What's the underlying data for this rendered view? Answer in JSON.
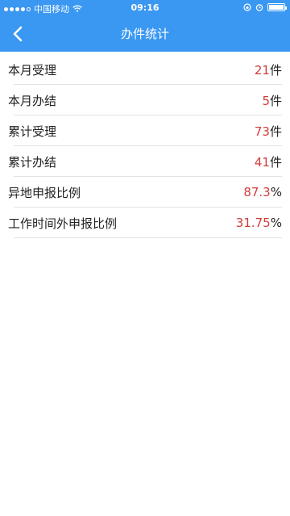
{
  "status_bar": {
    "carrier": "中国移动",
    "time": "09:16"
  },
  "nav": {
    "title": "办件统计"
  },
  "stats": [
    {
      "label": "本月受理",
      "value": "21",
      "unit": "件"
    },
    {
      "label": "本月办结",
      "value": "5",
      "unit": "件"
    },
    {
      "label": "累计受理",
      "value": "73",
      "unit": "件"
    },
    {
      "label": "累计办结",
      "value": "41",
      "unit": "件"
    },
    {
      "label": "异地申报比例",
      "value": "87.3",
      "unit": "%"
    },
    {
      "label": "工作时间外申报比例",
      "value": "31.75",
      "unit": "%"
    }
  ],
  "colors": {
    "header_bg": "#3a97f2",
    "value_color": "#d23b3b"
  }
}
